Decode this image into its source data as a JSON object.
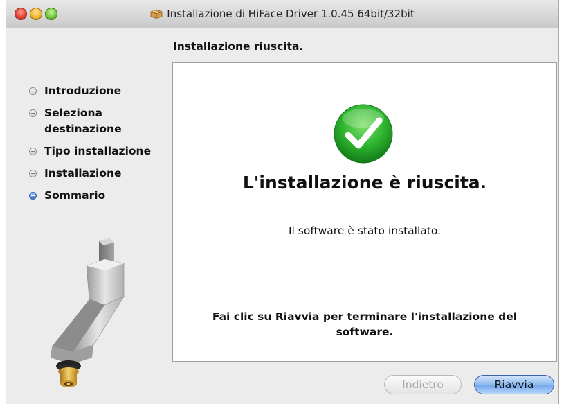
{
  "window": {
    "title": "Installazione di HiFace Driver 1.0.45 64bit/32bit",
    "title_icon": "package-icon"
  },
  "page": {
    "title": "Installazione riuscita."
  },
  "sidebar": {
    "steps": [
      {
        "label": "Introduzione",
        "active": false
      },
      {
        "label": "Seleziona destinazione",
        "active": false
      },
      {
        "label": "Tipo installazione",
        "active": false
      },
      {
        "label": "Installazione",
        "active": false
      },
      {
        "label": "Sommario",
        "active": true
      }
    ]
  },
  "content": {
    "icon": "success-checkmark-icon",
    "heading": "L'installazione è riuscita.",
    "message": "Il software è stato installato.",
    "instruction": "Fai clic su Riavvia per terminare l'installazione del software."
  },
  "buttons": {
    "back": {
      "label": "Indietro",
      "enabled": false
    },
    "restart": {
      "label": "Riavvia",
      "enabled": true
    }
  },
  "colors": {
    "accent": "#3a74cf",
    "success": "#2fb52f"
  }
}
